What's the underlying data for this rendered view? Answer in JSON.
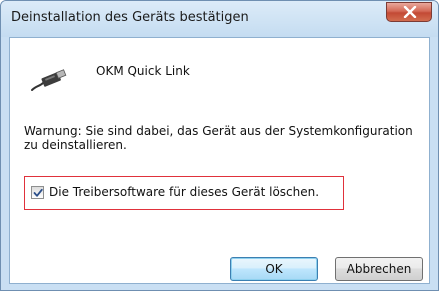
{
  "window": {
    "title": "Deinstallation des Geräts bestätigen"
  },
  "title_bar": {
    "close_icon": "close-x-icon",
    "close_color": "#c9503b"
  },
  "device": {
    "icon": "usb-plug-icon",
    "name": "OKM Quick Link"
  },
  "message": {
    "warning": "Warnung: Sie sind dabei, das Gerät aus der Systemkonfiguration zu deinstallieren."
  },
  "option": {
    "label": "Die Treibersoftware für dieses Gerät löschen.",
    "checked": true,
    "highlight_color": "#e0313b"
  },
  "buttons": {
    "ok": "OK",
    "cancel": "Abbrechen"
  }
}
